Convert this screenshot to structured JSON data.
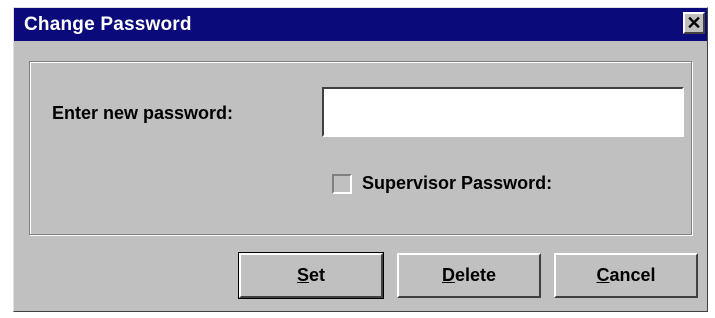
{
  "dialog": {
    "title": "Change Password",
    "close_glyph": "✕",
    "password_label": "Enter new password:",
    "password_value": "",
    "supervisor_checkbox": {
      "label": "Supervisor Password:",
      "checked": false
    },
    "buttons": {
      "set": {
        "mnemonic": "S",
        "rest": "et"
      },
      "delete": {
        "mnemonic": "D",
        "rest": "elete"
      },
      "cancel": {
        "mnemonic": "C",
        "rest": "ancel"
      }
    }
  },
  "colors": {
    "titlebar": "#0a0a7a",
    "window_bg": "#c0c0c0",
    "input_bg": "#ffffff"
  },
  "icons": {
    "close": "close-icon"
  }
}
